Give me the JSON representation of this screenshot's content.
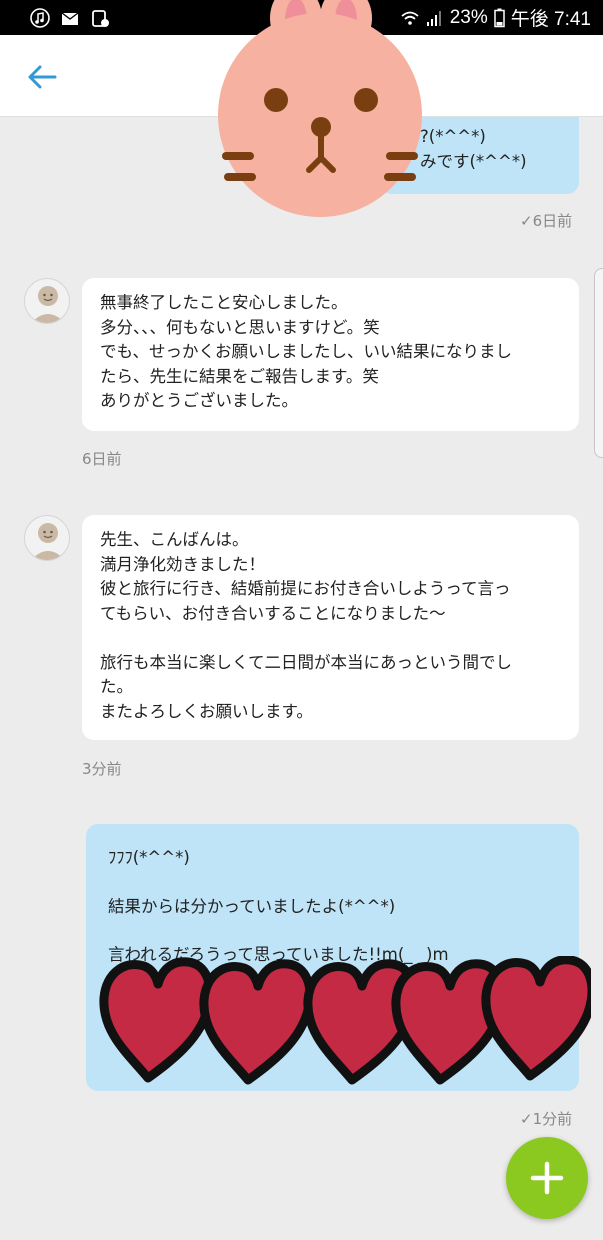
{
  "status_bar": {
    "battery": "23%",
    "time": "午後 7:41",
    "icons": [
      "music-icon",
      "mail-icon",
      "phone-icon",
      "wifi-icon",
      "signal-icon",
      "battery-icon"
    ]
  },
  "header": {
    "back_icon": "arrow-left-icon"
  },
  "messages": [
    {
      "side": "right",
      "lines": [
        "?(*^^*)",
        "みです(*^^*)"
      ],
      "time": "✓6日前"
    },
    {
      "side": "left",
      "lines": [
        "無事終了したこと安心しました。",
        "多分、、、何もないと思いますけど。笑",
        "でも、せっかくお願いしましたし、いい結果になりまし",
        "たら、先生に結果をご報告します。笑",
        "ありがとうございました。"
      ],
      "time": "6日前"
    },
    {
      "side": "left",
      "lines": [
        "先生、こんばんは。",
        "満月浄化効きました！",
        "彼と旅行に行き、結婚前提にお付き合いしようって言っ",
        "てもらい、お付き合いすることになりました〜",
        "",
        "旅行も本当に楽しくて二日間が本当にあっという間でし",
        "た。",
        "またよろしくお願いします。"
      ],
      "time": "3分前"
    },
    {
      "side": "right",
      "lines": [
        "ﾌﾌﾌ(*^^*)",
        "結果からは分かっていましたよ(*^^*)",
        "言われるだろうって思っていました!!m(_ _)m"
      ],
      "time": "✓1分前"
    }
  ],
  "fab": {
    "icon": "plus-icon"
  },
  "colors": {
    "accent": "#3399d6",
    "bubble_right": "#bfe4f7",
    "bubble_left": "#ffffff",
    "background": "#ececec",
    "fab": "#8bc921",
    "heart": "#c42a44",
    "sticker_face": "#f6b1a0"
  }
}
